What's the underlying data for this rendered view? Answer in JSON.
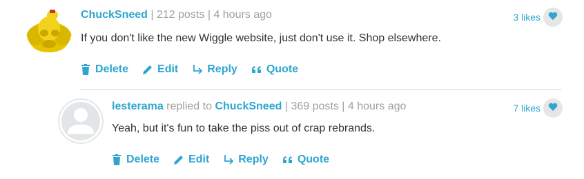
{
  "comments": [
    {
      "username": "ChuckSneed",
      "replied_to_label": "",
      "replied_to_user": "",
      "posts": "212 posts",
      "time": "4 hours ago",
      "body": "If you don't like the new Wiggle website, just don't use it. Shop elsewhere.",
      "likes": "3 likes",
      "actions": {
        "delete": "Delete",
        "edit": "Edit",
        "reply": "Reply",
        "quote": "Quote"
      }
    },
    {
      "username": "lesterama",
      "replied_to_label": "replied to",
      "replied_to_user": "ChuckSneed",
      "posts": "369 posts",
      "time": "4 hours ago",
      "body": "Yeah, but it's fun to take the piss out of crap rebrands.",
      "likes": "7 likes",
      "actions": {
        "delete": "Delete",
        "edit": "Edit",
        "reply": "Reply",
        "quote": "Quote"
      }
    }
  ],
  "separator": "|",
  "colors": {
    "accent": "#2ea6cf",
    "meta": "#a0a0a0",
    "text": "#333333"
  },
  "icons": [
    "trash-icon",
    "pencil-icon",
    "reply-arrow-icon",
    "quote-icon",
    "heart-icon"
  ]
}
